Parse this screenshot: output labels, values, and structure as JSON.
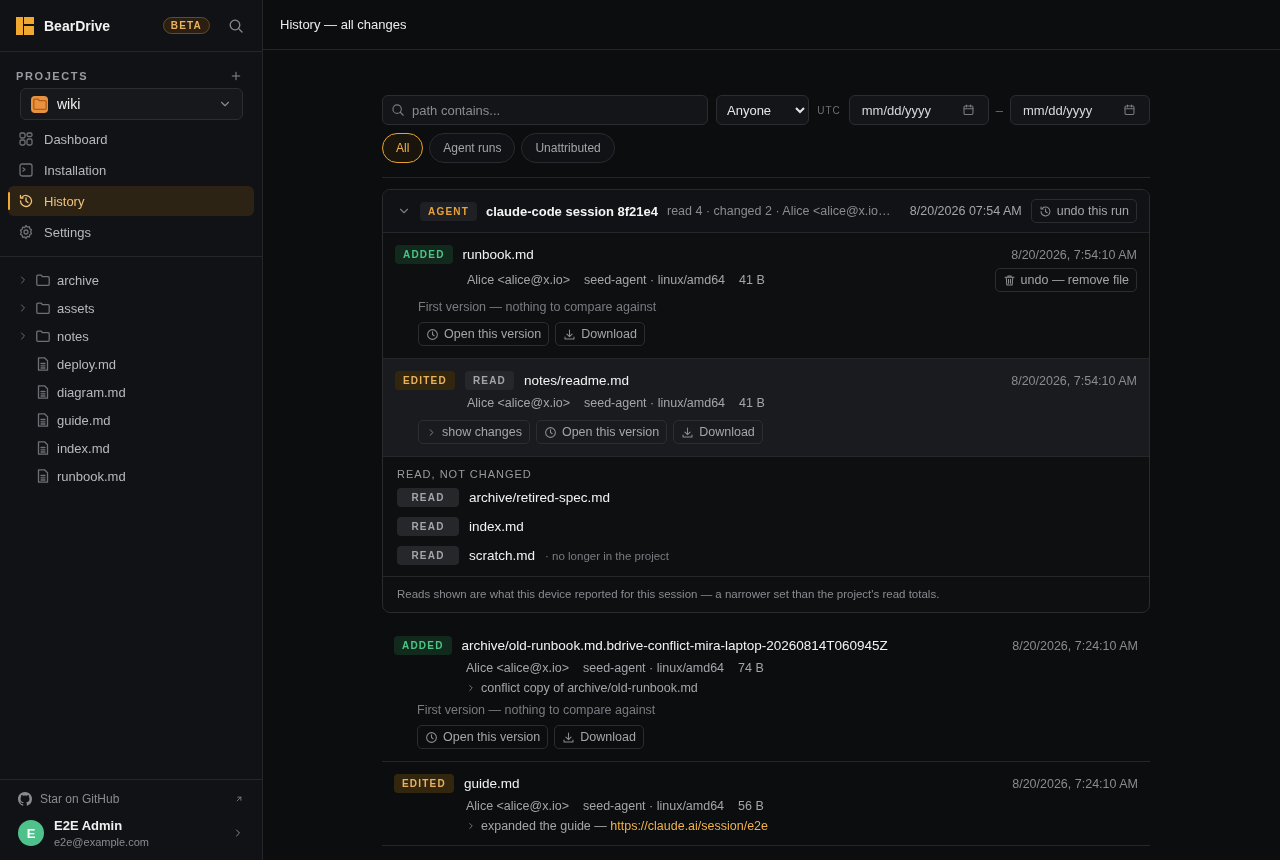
{
  "brand": {
    "name": "BearDrive",
    "badge": "BETA"
  },
  "projects": {
    "label": "PROJECTS",
    "current": "wiki"
  },
  "nav": [
    {
      "kind": "dashboard",
      "label": "Dashboard",
      "selected": false
    },
    {
      "kind": "terminal",
      "label": "Installation",
      "selected": false
    },
    {
      "kind": "history",
      "label": "History",
      "selected": true
    },
    {
      "kind": "settings",
      "label": "Settings",
      "selected": false
    }
  ],
  "tree": [
    {
      "kind": "folder",
      "name": "archive"
    },
    {
      "kind": "folder",
      "name": "assets"
    },
    {
      "kind": "folder",
      "name": "notes"
    },
    {
      "kind": "file",
      "name": "deploy.md"
    },
    {
      "kind": "file",
      "name": "diagram.md"
    },
    {
      "kind": "file",
      "name": "guide.md"
    },
    {
      "kind": "file",
      "name": "index.md"
    },
    {
      "kind": "file",
      "name": "runbook.md"
    }
  ],
  "github": "Star on GitHub",
  "user": {
    "initial": "E",
    "name": "E2E Admin",
    "email": "e2e@example.com"
  },
  "header": {
    "title": "History — all changes"
  },
  "filters": {
    "search_placeholder": "path contains...",
    "who": "Anyone",
    "timezone": "UTC",
    "from_placeholder": "mm/dd/yyyy",
    "range_separator": "–",
    "to_placeholder": "mm/dd/yyyy",
    "chips": [
      {
        "label": "All",
        "selected": true
      },
      {
        "label": "Agent runs",
        "selected": false
      },
      {
        "label": "Unattributed",
        "selected": false
      }
    ]
  },
  "session": {
    "expanded": true,
    "badge": "AGENT",
    "title": "claude-code session 8f21e4",
    "summary": "read 4 · changed 2 · Alice <alice@x.io…",
    "time": "8/20/2026 07:54 AM",
    "undo": "undo this run",
    "changes": [
      {
        "kind": "added",
        "status": "ADDED",
        "path": "runbook.md",
        "time": "8/20/2026, 7:54:10 AM",
        "author": "Alice <alice@x.io>",
        "agent": "seed-agent · linux/amd64",
        "size": "41 B",
        "undo": "undo — remove file",
        "info": "First version — nothing to compare against",
        "highlighted": false,
        "actions": [
          {
            "kind": "open",
            "label": "Open this version"
          },
          {
            "kind": "download",
            "label": "Download"
          }
        ]
      },
      {
        "kind": "edited",
        "status": "EDITED",
        "read_badge": "READ",
        "path": "notes/readme.md",
        "time": "8/20/2026, 7:54:10 AM",
        "author": "Alice <alice@x.io>",
        "agent": "seed-agent · linux/amd64",
        "size": "41 B",
        "highlighted": true,
        "actions": [
          {
            "kind": "show",
            "label": "show changes"
          },
          {
            "kind": "open",
            "label": "Open this version"
          },
          {
            "kind": "download",
            "label": "Download"
          }
        ]
      }
    ],
    "reads_heading": "READ, NOT CHANGED",
    "reads": [
      {
        "badge": "READ",
        "path": "archive/retired-spec.md"
      },
      {
        "badge": "READ",
        "path": "index.md"
      },
      {
        "badge": "READ",
        "path": "scratch.md",
        "note": "· no longer in the project"
      }
    ],
    "footnote": "Reads shown are what this device reported for this session — a narrower set than the project's read totals."
  },
  "entries": [
    {
      "kind": "added",
      "status": "ADDED",
      "path": "archive/old-runbook.md.bdrive-conflict-mira-laptop-20260814T060945Z",
      "time": "8/20/2026, 7:24:10 AM",
      "author": "Alice <alice@x.io>",
      "agent": "seed-agent · linux/amd64",
      "size": "74 B",
      "note": "conflict copy of archive/old-runbook.md",
      "info": "First version — nothing to compare against",
      "actions": [
        {
          "kind": "open",
          "label": "Open this version"
        },
        {
          "kind": "download",
          "label": "Download"
        }
      ]
    },
    {
      "kind": "edited",
      "status": "EDITED",
      "path": "guide.md",
      "time": "8/20/2026, 7:24:10 AM",
      "author": "Alice <alice@x.io>",
      "agent": "seed-agent · linux/amd64",
      "size": "56 B",
      "note": "expanded the guide — ",
      "note_link": "https://claude.ai/session/e2e"
    }
  ]
}
